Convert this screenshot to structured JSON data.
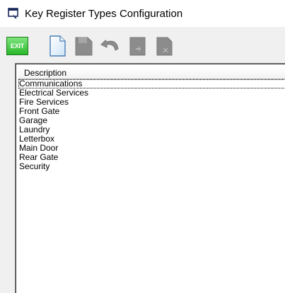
{
  "window": {
    "title": "Key Register Types Configuration",
    "icon": "window-app-icon"
  },
  "toolbar": {
    "exit_label": "EXIT",
    "buttons": [
      {
        "name": "new-icon",
        "state": "enabled"
      },
      {
        "name": "save-icon",
        "state": "disabled"
      },
      {
        "name": "undo-icon",
        "state": "disabled"
      },
      {
        "name": "insert-icon",
        "state": "disabled"
      },
      {
        "name": "delete-icon",
        "state": "disabled"
      }
    ]
  },
  "list": {
    "column_header": "Description",
    "rows": [
      "Communications",
      "Electrical Services",
      "Fire Services",
      "Front Gate",
      "Garage",
      "Laundry",
      "Letterbox",
      "Main Door",
      "Rear Gate",
      "Security"
    ],
    "selected_index": 0
  },
  "colors": {
    "exit_green": "#28b828",
    "disabled_gray": "#8c8c8c",
    "window_bg": "#f0f0f0"
  }
}
